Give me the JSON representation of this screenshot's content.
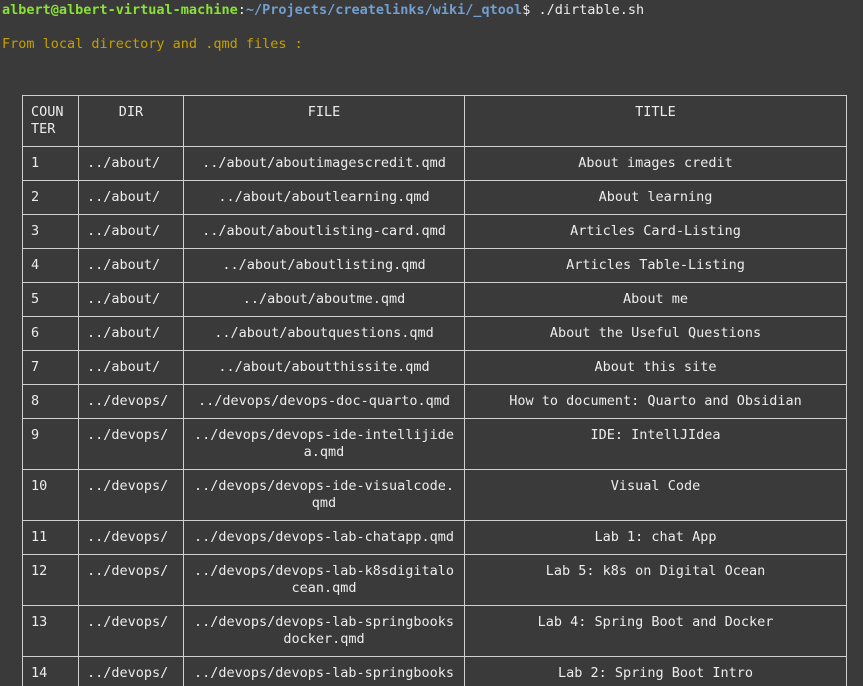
{
  "prompt": {
    "user_host": "albert@albert-virtual-machine",
    "colon": ":",
    "cwd": "~/Projects/createlinks/wiki/_qtool",
    "dollar": "$ ",
    "command": "./dirtable.sh"
  },
  "info": "From local directory and .qmd files :",
  "colors": {
    "background": "#3a3a3a",
    "user_host": "#8ae234",
    "cwd": "#729fcf",
    "info": "#c4a000",
    "text": "#ececec"
  },
  "table": {
    "headers": {
      "counter": "COUNTER",
      "dir": "DIR",
      "file": "FILE",
      "title": "TITLE"
    },
    "rows": [
      {
        "counter": "1",
        "dir": "../about/",
        "file": "../about/aboutimagescredit.qmd",
        "title": "About images credit"
      },
      {
        "counter": "2",
        "dir": "../about/",
        "file": "../about/aboutlearning.qmd",
        "title": "About learning"
      },
      {
        "counter": "3",
        "dir": "../about/",
        "file": "../about/aboutlisting-card.qmd",
        "title": "Articles Card-Listing"
      },
      {
        "counter": "4",
        "dir": "../about/",
        "file": "../about/aboutlisting.qmd",
        "title": "Articles Table-Listing"
      },
      {
        "counter": "5",
        "dir": "../about/",
        "file": "../about/aboutme.qmd",
        "title": "About me"
      },
      {
        "counter": "6",
        "dir": "../about/",
        "file": "../about/aboutquestions.qmd",
        "title": "About the Useful Questions"
      },
      {
        "counter": "7",
        "dir": "../about/",
        "file": "../about/aboutthissite.qmd",
        "title": "About this site"
      },
      {
        "counter": "8",
        "dir": "../devops/",
        "file": "../devops/devops-doc-quarto.qmd",
        "title": "How to document: Quarto and Obsidian"
      },
      {
        "counter": "9",
        "dir": "../devops/",
        "file": "../devops/devops-ide-intellijidea.qmd",
        "title": "IDE: IntellJIdea"
      },
      {
        "counter": "10",
        "dir": "../devops/",
        "file": "../devops/devops-ide-visualcode.qmd",
        "title": "Visual Code"
      },
      {
        "counter": "11",
        "dir": "../devops/",
        "file": "../devops/devops-lab-chatapp.qmd",
        "title": "Lab 1: chat App"
      },
      {
        "counter": "12",
        "dir": "../devops/",
        "file": "../devops/devops-lab-k8sdigitalocean.qmd",
        "title": "Lab 5: k8s on Digital Ocean"
      },
      {
        "counter": "13",
        "dir": "../devops/",
        "file": "../devops/devops-lab-springbooksdocker.qmd",
        "title": "Lab 4: Spring Boot and Docker"
      },
      {
        "counter": "14",
        "dir": "../devops/",
        "file": "../devops/devops-lab-springbooks",
        "title": "Lab 2: Spring Boot Intro"
      }
    ]
  }
}
